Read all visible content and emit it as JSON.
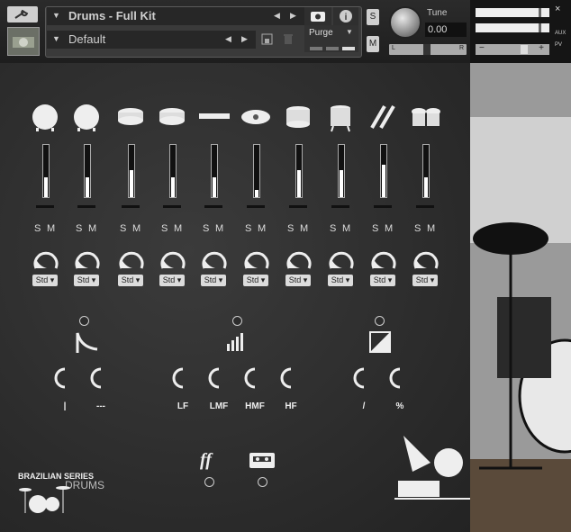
{
  "header": {
    "instrument_name": "Drums - Full Kit",
    "preset_name": "Default",
    "purge_label": "Purge",
    "solo_label": "S",
    "mute_label": "M",
    "tune_label": "Tune",
    "tune_value": "0.00",
    "pan_left": "L",
    "pan_right": "R",
    "close_label": "×",
    "aux_label": "AUX",
    "pv_label": "PV",
    "out_minus": "−",
    "out_plus": "+"
  },
  "channels": [
    {
      "icon": "bass-drum-1-icon",
      "solo": "S",
      "mute": "M",
      "curve": "Std ▾",
      "fader_level": 0.55
    },
    {
      "icon": "bass-drum-2-icon",
      "solo": "S",
      "mute": "M",
      "curve": "Std ▾",
      "fader_level": 0.55
    },
    {
      "icon": "snare-1-icon",
      "solo": "S",
      "mute": "M",
      "curve": "Std ▾",
      "fader_level": 0.75
    },
    {
      "icon": "snare-2-icon",
      "solo": "S",
      "mute": "M",
      "curve": "Std ▾",
      "fader_level": 0.55
    },
    {
      "icon": "rim-icon",
      "solo": "S",
      "mute": "M",
      "curve": "Std ▾",
      "fader_level": 0.55
    },
    {
      "icon": "cymbal-icon",
      "solo": "S",
      "mute": "M",
      "curve": "Std ▾",
      "fader_level": 0.2
    },
    {
      "icon": "tom-icon",
      "solo": "S",
      "mute": "M",
      "curve": "Std ▾",
      "fader_level": 0.75
    },
    {
      "icon": "floor-tom-icon",
      "solo": "S",
      "mute": "M",
      "curve": "Std ▾",
      "fader_level": 0.75
    },
    {
      "icon": "sticks-icon",
      "solo": "S",
      "mute": "M",
      "curve": "Std ▾",
      "fader_level": 0.9
    },
    {
      "icon": "hihat-icon",
      "solo": "S",
      "mute": "M",
      "curve": "Std ▾",
      "fader_level": 0.55
    }
  ],
  "effects": {
    "transient_labels": [
      "|",
      "---"
    ],
    "eq_labels": [
      "LF",
      "LMF",
      "HMF",
      "HF"
    ],
    "comp_labels": [
      "/",
      "%"
    ]
  },
  "brand": {
    "line1": "BRAZILIAN SERIES",
    "line2": "DRUMS"
  },
  "colors": {
    "board": "#2e2e2e",
    "chalk": "#eeeeee"
  }
}
